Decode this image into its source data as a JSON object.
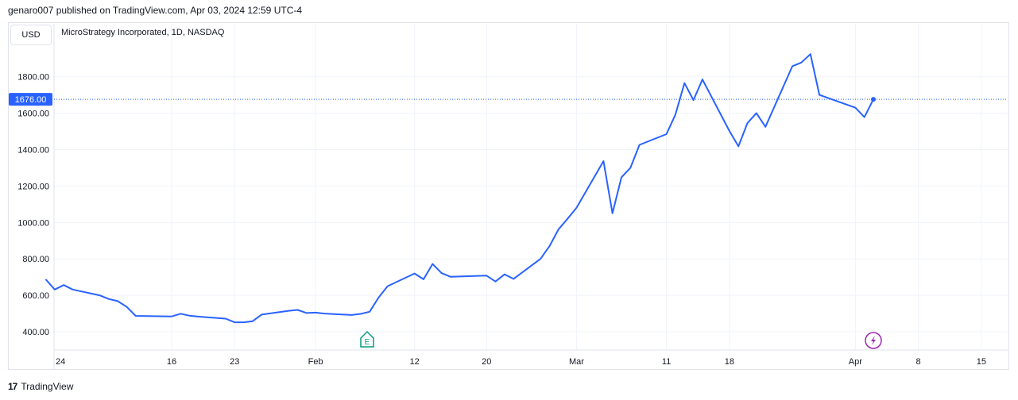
{
  "header": {
    "publisher": "genaro007 published on TradingView.com, Apr 03, 2024 12:59 UTC-4"
  },
  "currency_button": "USD",
  "symbol_title": "MicroStrategy Incorporated, 1D, NASDAQ",
  "last_price_label": "1676.00",
  "footer": {
    "logo": "17",
    "brand": "TradingView"
  },
  "markers": {
    "earnings": "E",
    "dividend_icon": "lightning-icon"
  },
  "colors": {
    "line": "#2962ff",
    "grid": "#f0f3fa",
    "earnings": "#089981",
    "flash": "#9c27b0"
  },
  "chart_data": {
    "type": "line",
    "title": "",
    "ylim": [
      320,
      1980
    ],
    "yticks": [
      "400.00",
      "600.00",
      "800.00",
      "1000.00",
      "1200.00",
      "1400.00",
      "1600.00",
      "1800.00"
    ],
    "ytick_values": [
      400,
      600,
      800,
      1000,
      1200,
      1400,
      1600,
      1800
    ],
    "xticks": [
      {
        "label": "24",
        "date": "2024-01-01"
      },
      {
        "label": "16",
        "date": "2024-01-16"
      },
      {
        "label": "23",
        "date": "2024-01-23"
      },
      {
        "label": "Feb",
        "date": "2024-02-01"
      },
      {
        "label": "12",
        "date": "2024-02-12"
      },
      {
        "label": "20",
        "date": "2024-02-20"
      },
      {
        "label": "Mar",
        "date": "2024-03-01"
      },
      {
        "label": "11",
        "date": "2024-03-11"
      },
      {
        "label": "18",
        "date": "2024-03-18"
      },
      {
        "label": "Apr",
        "date": "2024-04-01"
      },
      {
        "label": "8",
        "date": "2024-04-08"
      },
      {
        "label": "15",
        "date": "2024-04-15"
      }
    ],
    "series": [
      {
        "points": [
          [
            "2024-01-02",
            688
          ],
          [
            "2024-01-03",
            632
          ],
          [
            "2024-01-04",
            656
          ],
          [
            "2024-01-05",
            632
          ],
          [
            "2024-01-08",
            600
          ],
          [
            "2024-01-09",
            580
          ],
          [
            "2024-01-10",
            568
          ],
          [
            "2024-01-11",
            537
          ],
          [
            "2024-01-12",
            487
          ],
          [
            "2024-01-16",
            484
          ],
          [
            "2024-01-17",
            499
          ],
          [
            "2024-01-18",
            488
          ],
          [
            "2024-01-19",
            483
          ],
          [
            "2024-01-22",
            472
          ],
          [
            "2024-01-23",
            452
          ],
          [
            "2024-01-24",
            452
          ],
          [
            "2024-01-25",
            458
          ],
          [
            "2024-01-26",
            494
          ],
          [
            "2024-01-29",
            515
          ],
          [
            "2024-01-30",
            520
          ],
          [
            "2024-01-31",
            503
          ],
          [
            "2024-02-01",
            505
          ],
          [
            "2024-02-02",
            500
          ],
          [
            "2024-02-05",
            492
          ],
          [
            "2024-02-06",
            498
          ],
          [
            "2024-02-07",
            510
          ],
          [
            "2024-02-08",
            588
          ],
          [
            "2024-02-09",
            650
          ],
          [
            "2024-02-12",
            720
          ],
          [
            "2024-02-13",
            688
          ],
          [
            "2024-02-14",
            772
          ],
          [
            "2024-02-15",
            722
          ],
          [
            "2024-02-16",
            702
          ],
          [
            "2024-02-20",
            708
          ],
          [
            "2024-02-21",
            676
          ],
          [
            "2024-02-22",
            715
          ],
          [
            "2024-02-23",
            690
          ],
          [
            "2024-02-26",
            800
          ],
          [
            "2024-02-27",
            870
          ],
          [
            "2024-02-28",
            962
          ],
          [
            "2024-02-29",
            1020
          ],
          [
            "2024-03-01",
            1080
          ],
          [
            "2024-03-04",
            1337
          ],
          [
            "2024-03-05",
            1050
          ],
          [
            "2024-03-06",
            1248
          ],
          [
            "2024-03-07",
            1300
          ],
          [
            "2024-03-08",
            1426
          ],
          [
            "2024-03-11",
            1485
          ],
          [
            "2024-03-12",
            1592
          ],
          [
            "2024-03-13",
            1765
          ],
          [
            "2024-03-14",
            1672
          ],
          [
            "2024-03-15",
            1785
          ],
          [
            "2024-03-18",
            1502
          ],
          [
            "2024-03-19",
            1418
          ],
          [
            "2024-03-20",
            1545
          ],
          [
            "2024-03-21",
            1600
          ],
          [
            "2024-03-22",
            1525
          ],
          [
            "2024-03-25",
            1858
          ],
          [
            "2024-03-26",
            1878
          ],
          [
            "2024-03-27",
            1924
          ],
          [
            "2024-03-28",
            1700
          ],
          [
            "2024-04-01",
            1630
          ],
          [
            "2024-04-02",
            1578
          ],
          [
            "2024-04-03",
            1676
          ]
        ]
      }
    ],
    "grid": true
  }
}
